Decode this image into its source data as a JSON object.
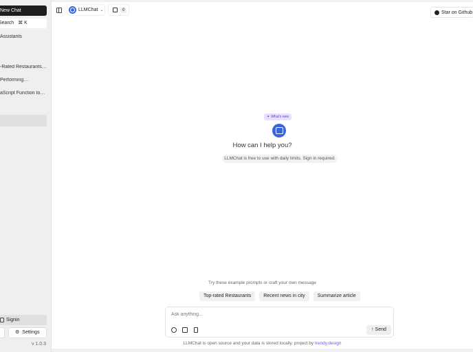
{
  "sidebar": {
    "new_chat": "New Chat",
    "search": "Search",
    "search_shortcut": "⌘ K",
    "assistants": "Assistants",
    "threads": [
      "-Rated Restaurants…",
      "Performing…",
      "aScript Function to…"
    ],
    "signin": "Signin",
    "settings": "Settings",
    "version": "v 1.0.3"
  },
  "header": {
    "model": "LLMChat",
    "credits": "0",
    "github": "Star on Github"
  },
  "main": {
    "whats_new": "What's new",
    "headline": "How can I help you?",
    "note": "LLMChat is free to use with daily limits. Sign in required.",
    "try_text": "Try these example prompts or craft your own message",
    "examples": [
      "Top-rated Restaurants",
      "Recent news in city",
      "Summarize article"
    ],
    "input_placeholder": "Ask anything...",
    "send": "Send",
    "footer_text": "LLMChat is open source and your data is stored locally. project by ",
    "footer_link": "trendy.design"
  },
  "icons": {
    "panel": "sidebar-toggle-icon",
    "calendar": "calendar-icon",
    "github": "github-icon",
    "send": "arrow-up-icon"
  }
}
